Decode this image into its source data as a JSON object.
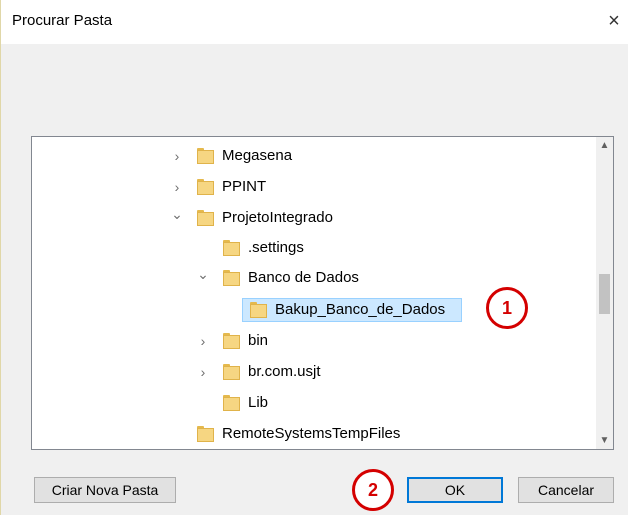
{
  "dialog": {
    "title": "Procurar Pasta",
    "close_glyph": "×"
  },
  "tree": {
    "items": [
      {
        "label": "Megasena",
        "expander": "›",
        "state": "collapsed"
      },
      {
        "label": "PPINT",
        "expander": "›",
        "state": "collapsed"
      },
      {
        "label": "ProjetoIntegrado",
        "expander": "⌄",
        "state": "expanded"
      },
      {
        "label": ".settings",
        "expander": "",
        "state": "leaf"
      },
      {
        "label": "Banco de Dados",
        "expander": "⌄",
        "state": "expanded"
      },
      {
        "label": "Bakup_Banco_de_Dados",
        "expander": "",
        "state": "selected"
      },
      {
        "label": "bin",
        "expander": "›",
        "state": "collapsed"
      },
      {
        "label": "br.com.usjt",
        "expander": "›",
        "state": "collapsed"
      },
      {
        "label": "Lib",
        "expander": "",
        "state": "leaf"
      },
      {
        "label": "RemoteSystemsTempFiles",
        "expander": "",
        "state": "leaf"
      }
    ],
    "scroll_up_glyph": "▲",
    "scroll_down_glyph": "▼"
  },
  "annotations": {
    "one": "1",
    "two": "2",
    "color": "#d40000"
  },
  "buttons": {
    "new_folder": "Criar Nova Pasta",
    "ok": "OK",
    "cancel": "Cancelar"
  },
  "colors": {
    "selection": "#cce8ff",
    "folder": "#f6d682",
    "default_button_border": "#0078d7"
  }
}
